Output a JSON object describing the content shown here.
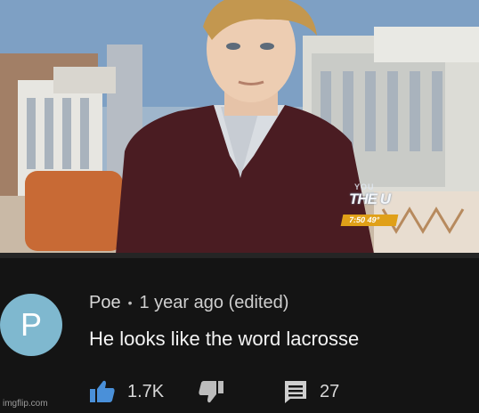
{
  "video": {
    "channel_bug_top": "YOU",
    "channel_bug_logo": "THE U",
    "bug_time": "7:50  49°"
  },
  "comment": {
    "avatar_letter": "P",
    "author": "Poe",
    "separator": "•",
    "time": "1 year ago (edited)",
    "text": "He looks like the word lacrosse",
    "like_count": "1.7K",
    "reply_count": "27",
    "colors": {
      "panel_bg": "#141414",
      "avatar_bg": "#7fb8cf",
      "like_icon": "#4a90d9",
      "dislike_icon": "#bdbdbd",
      "reply_icon": "#cfcfcf"
    },
    "icons": [
      "thumbs-up-icon",
      "thumbs-down-icon",
      "reply-comment-icon"
    ]
  },
  "watermark": "imgflip.com"
}
